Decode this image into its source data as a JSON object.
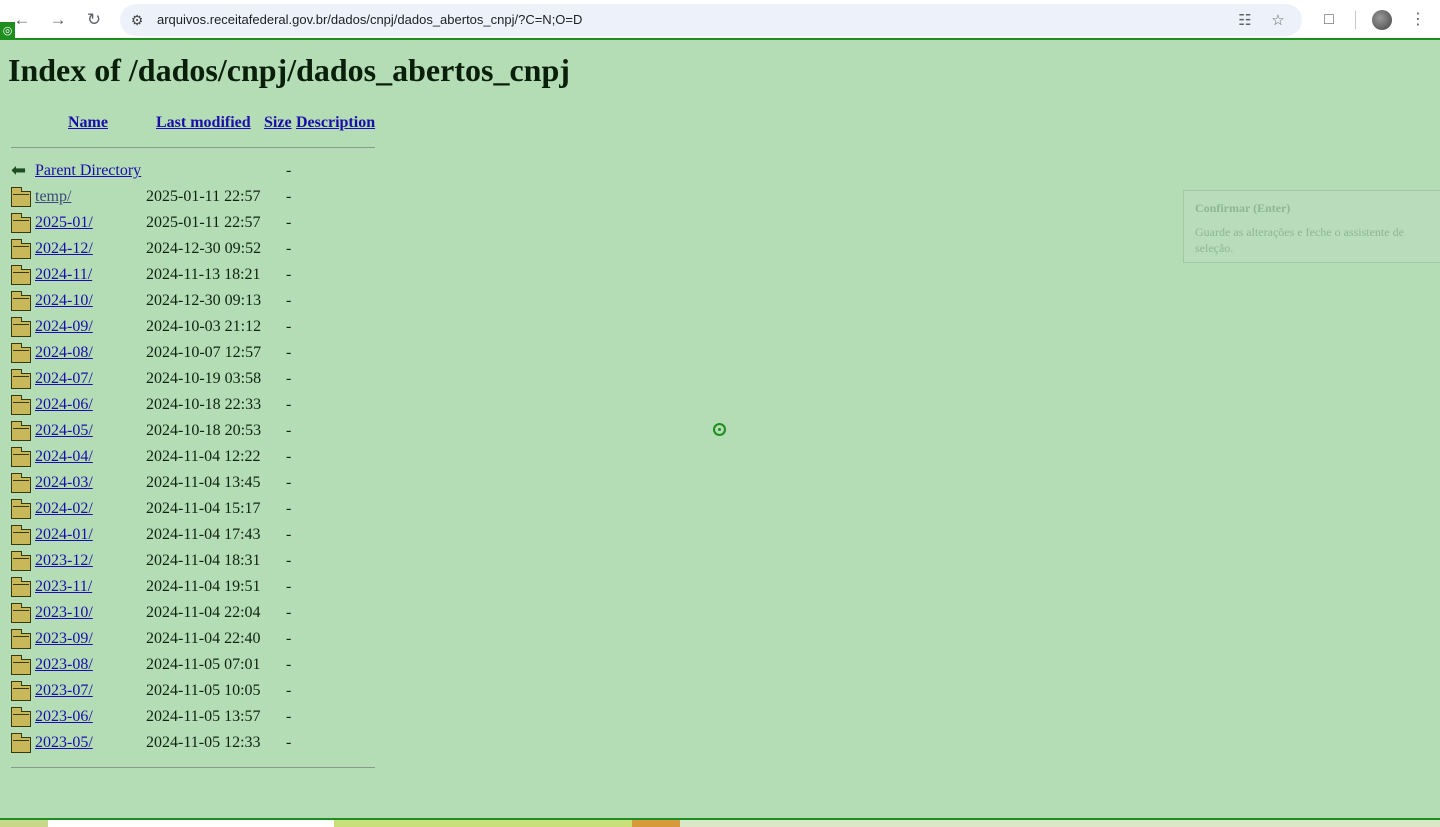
{
  "browser": {
    "url": "arquivos.receitafederal.gov.br/dados/cnpj/dados_abertos_cnpj/?C=N;O=D"
  },
  "page": {
    "title": "Index of /dados/cnpj/dados_abertos_cnpj"
  },
  "table": {
    "headers": {
      "name": "Name",
      "last_modified": "Last modified",
      "size": "Size",
      "description": "Description"
    },
    "parent": {
      "name": "Parent Directory",
      "size": "-"
    },
    "rows": [
      {
        "name": "temp/",
        "date": "2025-01-11 22:57",
        "size": "-"
      },
      {
        "name": "2025-01/",
        "date": "2025-01-11 22:57",
        "size": "-"
      },
      {
        "name": "2024-12/",
        "date": "2024-12-30 09:52",
        "size": "-"
      },
      {
        "name": "2024-11/",
        "date": "2024-11-13 18:21",
        "size": "-"
      },
      {
        "name": "2024-10/",
        "date": "2024-12-30 09:13",
        "size": "-"
      },
      {
        "name": "2024-09/",
        "date": "2024-10-03 21:12",
        "size": "-"
      },
      {
        "name": "2024-08/",
        "date": "2024-10-07 12:57",
        "size": "-"
      },
      {
        "name": "2024-07/",
        "date": "2024-10-19 03:58",
        "size": "-"
      },
      {
        "name": "2024-06/",
        "date": "2024-10-18 22:33",
        "size": "-"
      },
      {
        "name": "2024-05/",
        "date": "2024-10-18 20:53",
        "size": "-"
      },
      {
        "name": "2024-04/",
        "date": "2024-11-04 12:22",
        "size": "-"
      },
      {
        "name": "2024-03/",
        "date": "2024-11-04 13:45",
        "size": "-"
      },
      {
        "name": "2024-02/",
        "date": "2024-11-04 15:17",
        "size": "-"
      },
      {
        "name": "2024-01/",
        "date": "2024-11-04 17:43",
        "size": "-"
      },
      {
        "name": "2023-12/",
        "date": "2024-11-04 18:31",
        "size": "-"
      },
      {
        "name": "2023-11/",
        "date": "2024-11-04 19:51",
        "size": "-"
      },
      {
        "name": "2023-10/",
        "date": "2024-11-04 22:04",
        "size": "-"
      },
      {
        "name": "2023-09/",
        "date": "2024-11-04 22:40",
        "size": "-"
      },
      {
        "name": "2023-08/",
        "date": "2024-11-05 07:01",
        "size": "-"
      },
      {
        "name": "2023-07/",
        "date": "2024-11-05 10:05",
        "size": "-"
      },
      {
        "name": "2023-06/",
        "date": "2024-11-05 13:57",
        "size": "-"
      },
      {
        "name": "2023-05/",
        "date": "2024-11-05 12:33",
        "size": "-"
      }
    ]
  },
  "assistant": {
    "title": "Confirmar (Enter)",
    "body": "Guarde as alterações e feche o assistente de seleção."
  },
  "icons": {
    "back": "arrow-left-icon",
    "forward": "arrow-right-icon",
    "reload": "reload-icon",
    "site_info": "site-settings-icon",
    "translate": "translate-icon",
    "bookmark": "star-icon",
    "extensions": "puzzle-icon",
    "menu": "kebab-menu-icon",
    "folder": "folder-icon",
    "parent": "back-arrow-icon"
  }
}
